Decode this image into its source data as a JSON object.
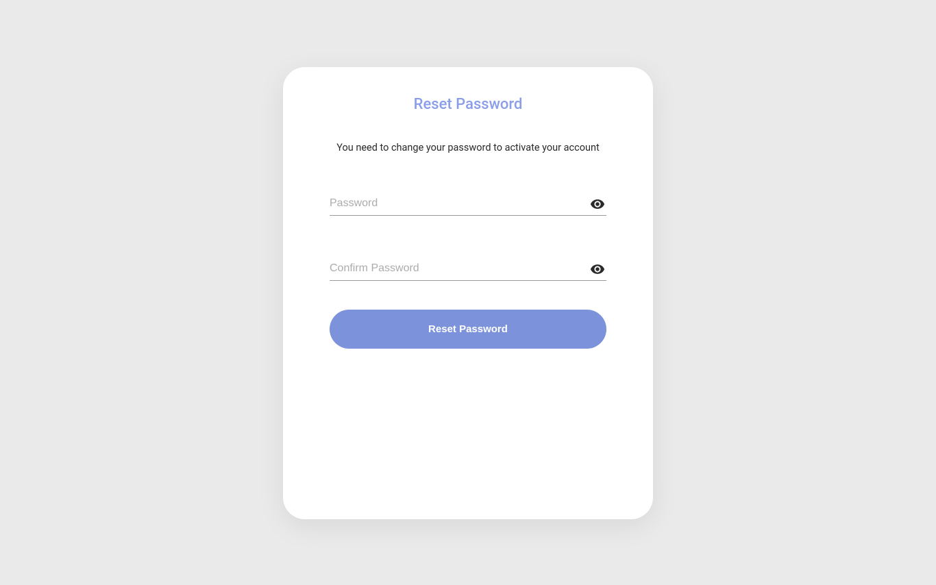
{
  "card": {
    "title": "Reset Password",
    "subtitle": "You need to change your password to activate your account"
  },
  "form": {
    "password": {
      "placeholder": "Password",
      "value": ""
    },
    "confirmPassword": {
      "placeholder": "Confirm Password",
      "value": ""
    },
    "submitLabel": "Reset Password"
  }
}
